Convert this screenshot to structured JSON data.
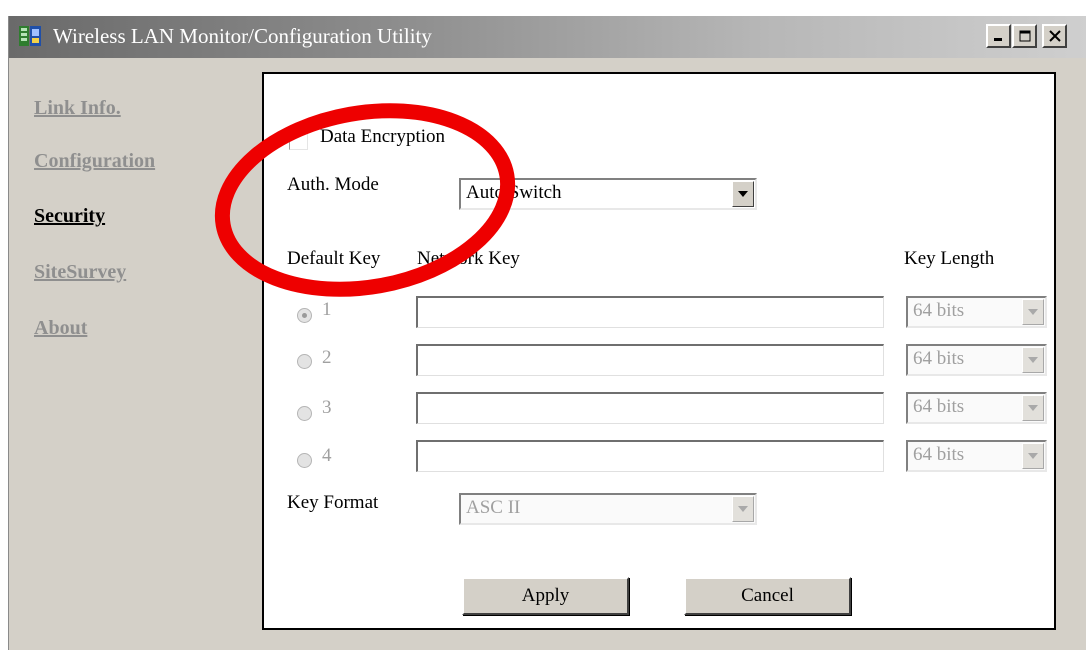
{
  "window": {
    "title": "Wireless LAN Monitor/Configuration Utility",
    "controls": {
      "minimize": "_",
      "maximize": "□",
      "close": "✕"
    }
  },
  "sidebar": {
    "items": [
      {
        "label": "Link Info.",
        "active": false
      },
      {
        "label": "Configuration",
        "active": false
      },
      {
        "label": "Security",
        "active": true
      },
      {
        "label": "SiteSurvey",
        "active": false
      },
      {
        "label": "About",
        "active": false
      }
    ]
  },
  "security": {
    "data_encryption": {
      "label": "Data Encryption",
      "checked": false
    },
    "auth_mode": {
      "label": "Auth. Mode",
      "value": "Auto Switch"
    },
    "headers": {
      "default_key": "Default Key",
      "network_key": "Network Key",
      "key_length": "Key Length"
    },
    "keys": [
      {
        "number": "1",
        "selected": true,
        "value": "",
        "length": "64 bits"
      },
      {
        "number": "2",
        "selected": false,
        "value": "",
        "length": "64 bits"
      },
      {
        "number": "3",
        "selected": false,
        "value": "",
        "length": "64 bits"
      },
      {
        "number": "4",
        "selected": false,
        "value": "",
        "length": "64 bits"
      }
    ],
    "key_format": {
      "label": "Key Format",
      "value": "ASC II"
    },
    "buttons": {
      "apply": "Apply",
      "cancel": "Cancel"
    }
  },
  "colors": {
    "annotation": "#ee0000",
    "window_face": "#d4d0c8",
    "disabled_text": "#a0a0a0",
    "nav_inactive": "#8f8f8f"
  },
  "annotation": {
    "shape": "ellipse",
    "target": "auth-mode-area"
  }
}
